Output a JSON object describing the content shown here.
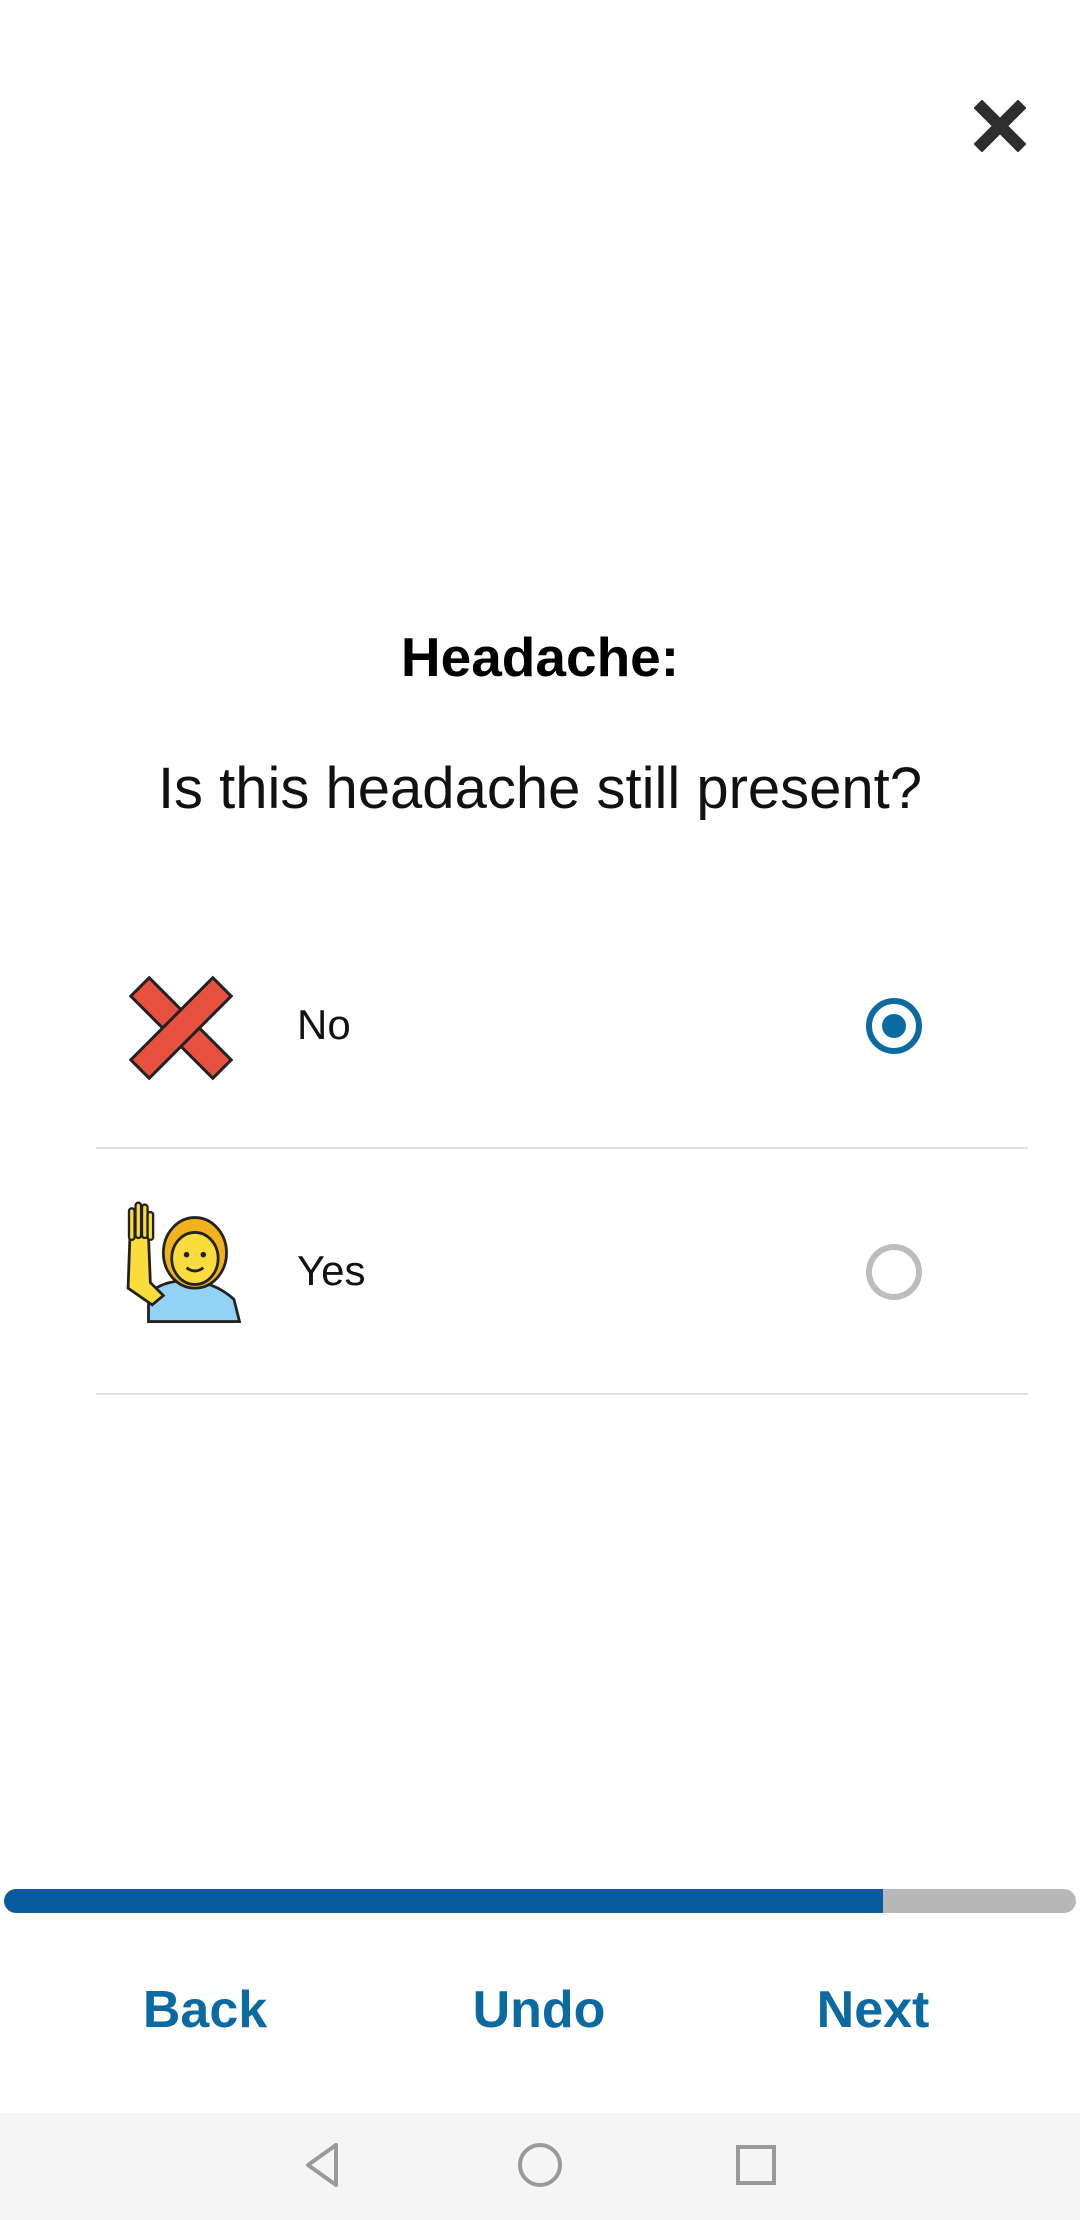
{
  "header": {
    "close_icon": "close-icon"
  },
  "question": {
    "title": "Headache:",
    "text": "Is this headache still present?"
  },
  "options": [
    {
      "label": "No",
      "icon": "red-x-icon",
      "selected": true
    },
    {
      "label": "Yes",
      "icon": "person-raising-hand-icon",
      "selected": false
    }
  ],
  "progress": {
    "fraction": 0.82
  },
  "footer": {
    "back_label": "Back",
    "undo_label": "Undo",
    "next_label": "Next"
  },
  "system_nav": {
    "back_icon": "triangle-back-icon",
    "home_icon": "circle-home-icon",
    "recents_icon": "square-recents-icon"
  },
  "colors": {
    "accent": "#0b6aa2",
    "progress_fill": "#075b9e",
    "progress_track": "#b8b8b8",
    "divider": "#e2e2e2"
  }
}
